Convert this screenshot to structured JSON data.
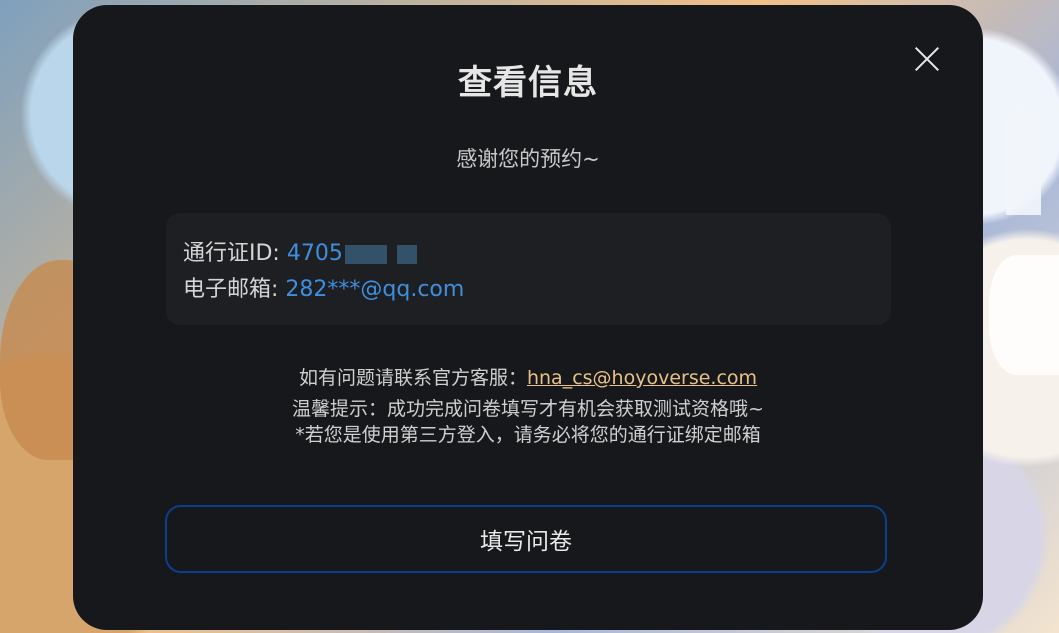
{
  "modal": {
    "title": "查看信息",
    "subtitle": "感谢您的预约~",
    "close_icon": "close-icon"
  },
  "account": {
    "passport_label": "通行证ID: ",
    "passport_visible": "4705",
    "email_label": "电子邮箱: ",
    "email_value": "282***@qq.com"
  },
  "support": {
    "contact_prefix": "如有问题请联系官方客服：",
    "email": "hna_cs@hoyoverse.com",
    "tip": "温馨提示：成功完成问卷填写才有机会获取测试资格哦~",
    "notice": "*若您是使用第三方登入，请务必将您的通行证绑定邮箱"
  },
  "actions": {
    "survey_button": "填写问卷"
  },
  "colors": {
    "modal_bg": "#17181b",
    "accent_blue": "#3f8fdf",
    "link_gold": "#e7c189",
    "button_border": "#0b3f8e"
  }
}
